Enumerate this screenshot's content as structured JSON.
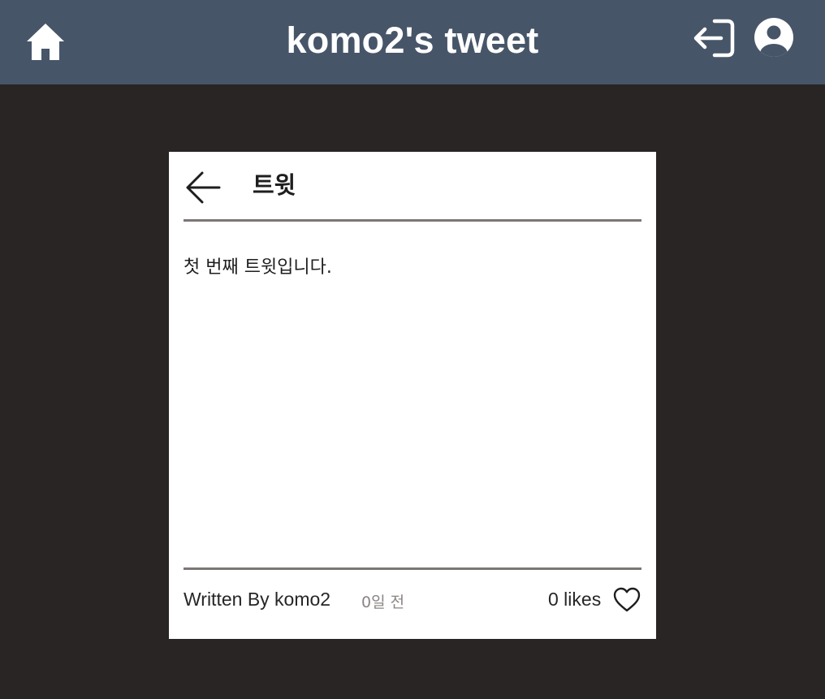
{
  "header": {
    "title": "komo2's tweet",
    "icons": {
      "home": "home-icon",
      "logout": "logout-icon",
      "profile": "user-circle-icon"
    },
    "background_color": "#475569"
  },
  "card": {
    "title": "트윗",
    "back_icon": "arrow-left-icon",
    "content": "첫 번째 트윗입니다.",
    "author": "Written By komo2",
    "timestamp": "0일 전",
    "likes": "0 likes",
    "like_icon": "heart-outline-icon"
  },
  "colors": {
    "page_background": "#282524",
    "card_background": "#ffffff",
    "divider": "#7c7674"
  }
}
